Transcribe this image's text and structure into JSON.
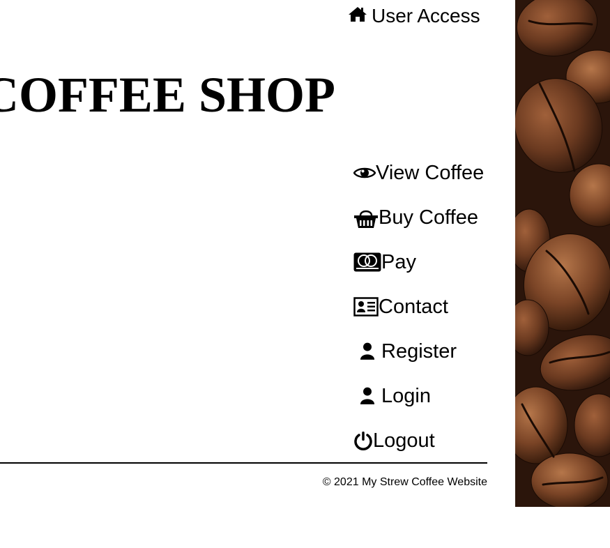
{
  "header": {
    "user_access_label": "User Access",
    "user_access_icon": "home-icon"
  },
  "title": "COFFEE SHOP",
  "nav": {
    "items": [
      {
        "label": "View Coffee",
        "icon": "eye-icon"
      },
      {
        "label": "Buy Coffee",
        "icon": "basket-icon"
      },
      {
        "label": "Pay",
        "icon": "mastercard-icon"
      },
      {
        "label": "Contact",
        "icon": "contact-card-icon"
      },
      {
        "label": "Register",
        "icon": "user-icon"
      },
      {
        "label": "Login",
        "icon": "user-icon"
      },
      {
        "label": "Logout",
        "icon": "power-icon"
      }
    ]
  },
  "footer": {
    "copyright": "© 2021 My Strew Coffee Website"
  },
  "image": {
    "subject": "coffee-beans-image"
  },
  "colors": {
    "text": "#000000",
    "background": "#ffffff",
    "bean_dark": "#3a1f12",
    "bean_mid": "#6b3a20",
    "bean_light": "#8b4f2b"
  }
}
